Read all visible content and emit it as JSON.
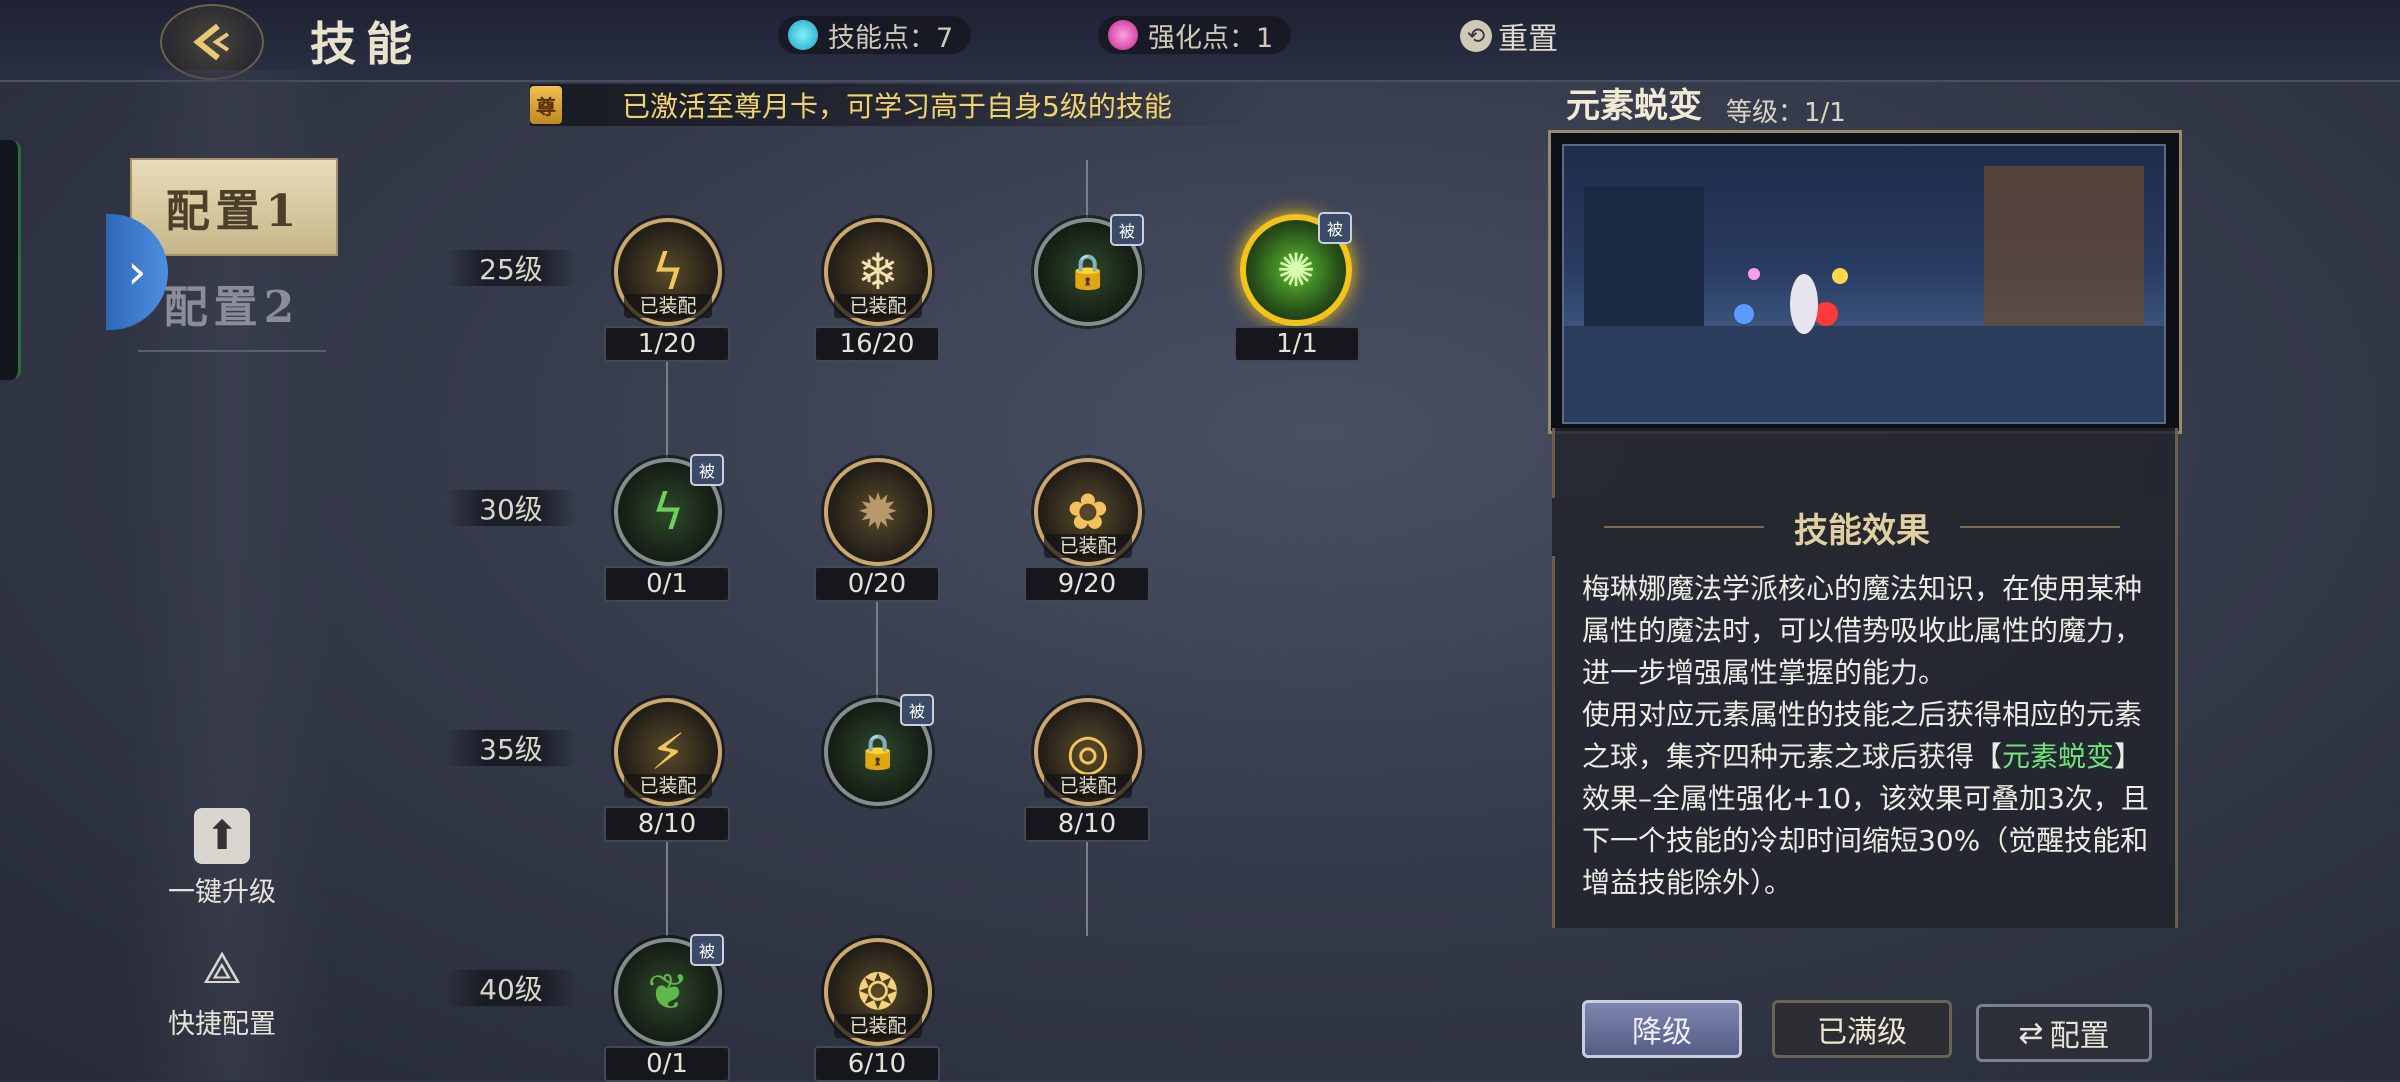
{
  "header": {
    "title": "技能",
    "skill_points_label": "技能点：7",
    "enhance_points_label": "强化点：1",
    "reset_label": "重置"
  },
  "sidebar": {
    "config1": "配置1",
    "config2": "配置2",
    "upgrade_label": "一键升级",
    "quick_config_label": "快捷配置"
  },
  "banner": {
    "badge": "尊",
    "text": "已激活至尊月卡，可学习高于自身5级的技能"
  },
  "tree": {
    "levels": [
      "25级",
      "30级",
      "35级",
      "40级"
    ],
    "equipped_label": "已装配",
    "passive_label": "被",
    "nodes": [
      {
        "row": 0,
        "col": 0,
        "progress": "1/20",
        "equipped": true,
        "passive": false,
        "locked": false,
        "icon": "lightning-icon"
      },
      {
        "row": 0,
        "col": 1,
        "progress": "16/20",
        "equipped": true,
        "passive": false,
        "locked": false,
        "icon": "snowflake-icon"
      },
      {
        "row": 0,
        "col": 2,
        "progress": "",
        "equipped": false,
        "passive": true,
        "locked": true,
        "icon": "lock-icon"
      },
      {
        "row": 0,
        "col": 3,
        "progress": "1/1",
        "equipped": false,
        "passive": true,
        "locked": false,
        "selected": true,
        "icon": "element-orb-icon"
      },
      {
        "row": 1,
        "col": 0,
        "progress": "0/1",
        "equipped": false,
        "passive": true,
        "locked": false,
        "icon": "nature-bolt-icon"
      },
      {
        "row": 1,
        "col": 1,
        "progress": "0/20",
        "equipped": false,
        "passive": false,
        "locked": false,
        "icon": "vortex-icon"
      },
      {
        "row": 1,
        "col": 2,
        "progress": "9/20",
        "equipped": true,
        "passive": false,
        "locked": false,
        "icon": "burst-icon"
      },
      {
        "row": 2,
        "col": 0,
        "progress": "8/10",
        "equipped": true,
        "passive": false,
        "locked": false,
        "icon": "storm-icon"
      },
      {
        "row": 2,
        "col": 1,
        "progress": "",
        "equipped": false,
        "passive": true,
        "locked": true,
        "icon": "lock-icon"
      },
      {
        "row": 2,
        "col": 2,
        "progress": "8/10",
        "equipped": true,
        "passive": false,
        "locked": false,
        "icon": "ring-icon"
      },
      {
        "row": 3,
        "col": 0,
        "progress": "0/1",
        "equipped": false,
        "passive": true,
        "locked": false,
        "icon": "leaf-bolt-icon"
      },
      {
        "row": 3,
        "col": 1,
        "progress": "6/10",
        "equipped": true,
        "passive": false,
        "locked": false,
        "icon": "swirl-icon"
      }
    ]
  },
  "detail": {
    "name": "元素蜕变",
    "level": "等级：1/1",
    "effect_title": "技能效果",
    "desc_part1": "梅琳娜魔法学派核心的魔法知识，在使用某种属性的魔法时，可以借势吸收此属性的魔力，进一步增强属性掌握的能力。",
    "desc_part2": "使用对应元素属性的技能之后获得相应的元素之球，集齐四种元素之球后获得【",
    "desc_highlight": "元素蜕变",
    "desc_part3": "】效果–全属性强化+10，该效果可叠加3次，且下一个技能的冷却时间缩短30%（觉醒技能和增益技能除外）。",
    "btn_downgrade": "降级",
    "btn_maxed": "已满级",
    "btn_config": "配置"
  },
  "colors": {
    "highlight_green": "#6fe27a",
    "banner_gold": "#f2d36b",
    "active_ring": "#f3c21b"
  }
}
